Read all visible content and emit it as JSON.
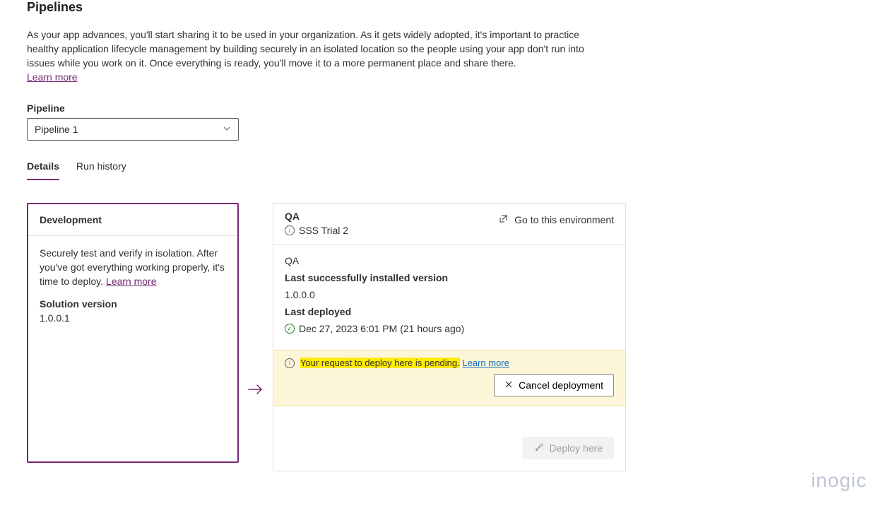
{
  "page": {
    "title": "Pipelines",
    "description": "As your app advances, you'll start sharing it to be used in your organization. As it gets widely adopted, it's important to practice healthy application lifecycle management by building securely in an isolated location so the people using your app don't run into issues while you work on it. Once everything is ready, you'll move it to a more permanent place and share there.",
    "learn_more": "Learn more"
  },
  "pipeline_select": {
    "label": "Pipeline",
    "value": "Pipeline 1"
  },
  "tabs": {
    "details": "Details",
    "run_history": "Run history"
  },
  "dev_card": {
    "title": "Development",
    "desc": "Securely test and verify in isolation. After you've got everything working properly, it's time to deploy. ",
    "learn_more": "Learn more",
    "solution_version_label": "Solution version",
    "solution_version_value": "1.0.0.1"
  },
  "qa_card": {
    "title": "QA",
    "subtitle": "SSS Trial 2",
    "goto_link": "Go to this environment",
    "body_title": "QA",
    "last_installed_label": "Last successfully installed version",
    "last_installed_value": "1.0.0.0",
    "last_deployed_label": "Last deployed",
    "last_deployed_value": "Dec 27, 2023 6:01 PM (21 hours ago)",
    "alert_text": "Your request to deploy here is pending.",
    "alert_learn_more": "Learn more",
    "cancel_btn": "Cancel deployment",
    "deploy_btn": "Deploy here"
  },
  "watermark": "inogic"
}
